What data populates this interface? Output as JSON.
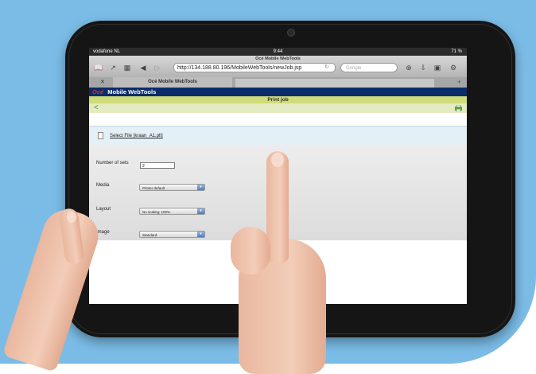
{
  "status": {
    "carrier": "vodafone NL",
    "time": "9:44",
    "battery": "71 %"
  },
  "browser": {
    "page_caption": "Océ Mobile WebTools",
    "url": "http://134.188.80.196/MobileWebTools/newJob.jsp",
    "search_placeholder": "Google",
    "tab_title": "Océ Mobile WebTools",
    "tab_close": "✕",
    "tab_add": "+",
    "icons": [
      "bookmarks-icon",
      "share-icon",
      "tabs-icon",
      "back-icon",
      "forward-icon",
      "reload-icon",
      "clock-icon",
      "download-icon",
      "reader-icon",
      "settings-icon"
    ]
  },
  "app": {
    "brand": "Océ",
    "name": "Mobile WebTools",
    "page_title": "Print job",
    "back_glyph": "<",
    "file_link": "Select File [kraan_A1.plt]",
    "fields": [
      {
        "label": "Number of sets",
        "value": "2"
      },
      {
        "label": "Media",
        "value": "Printer default"
      },
      {
        "label": "Layout",
        "value": "No scaling; 100%"
      },
      {
        "label": "Image",
        "value": "Standard"
      }
    ]
  },
  "colors": {
    "background_blue": "#7bbce6",
    "tablet_frame": "#151515",
    "app_header": "#0a2c6a",
    "title_bar": "#cfdc7a",
    "brand_red": "#e2301f"
  }
}
